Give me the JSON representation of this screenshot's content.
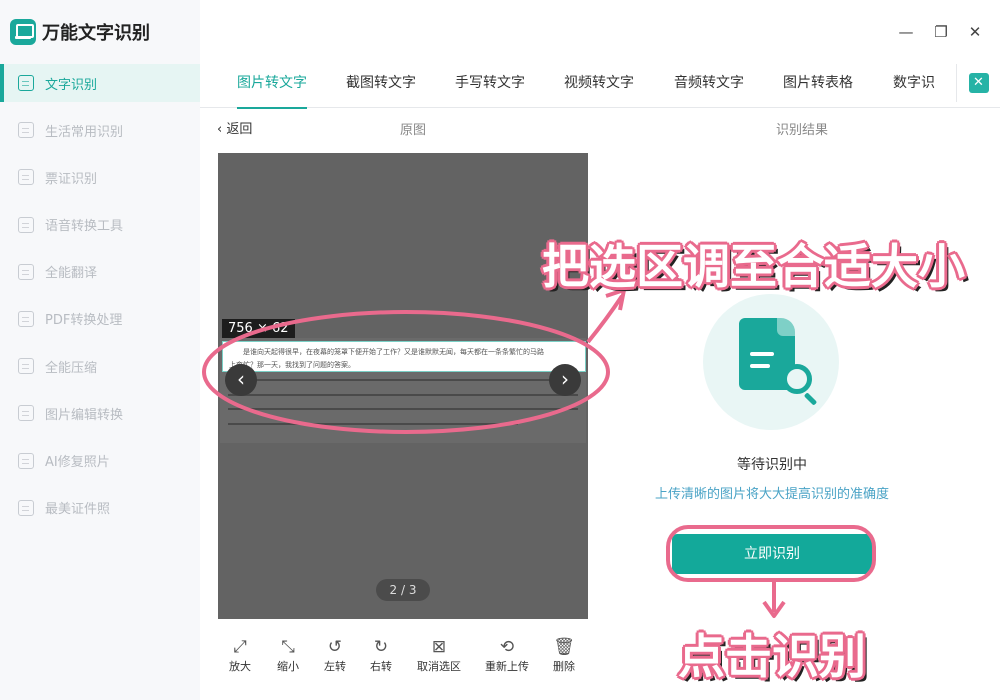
{
  "app": {
    "name": "万能文字识别"
  },
  "window": {
    "minimize": "—",
    "maximize": "❐",
    "close": "✕"
  },
  "sidebar": {
    "items": [
      {
        "label": "文字识别",
        "active": true
      },
      {
        "label": "生活常用识别"
      },
      {
        "label": "票证识别"
      },
      {
        "label": "语音转换工具"
      },
      {
        "label": "全能翻译"
      },
      {
        "label": "PDF转换处理"
      },
      {
        "label": "全能压缩"
      },
      {
        "label": "图片编辑转换"
      },
      {
        "label": "AI修复照片"
      },
      {
        "label": "最美证件照"
      }
    ]
  },
  "tabs": [
    {
      "label": "图片转文字",
      "active": true
    },
    {
      "label": "截图转文字"
    },
    {
      "label": "手写转文字"
    },
    {
      "label": "视频转文字"
    },
    {
      "label": "音频转文字"
    },
    {
      "label": "图片转表格"
    },
    {
      "label": "数字识"
    }
  ],
  "subheader": {
    "back": "返回",
    "original": "原图",
    "result": "识别结果"
  },
  "preview": {
    "selection_size": "756 × 62",
    "selection_line1": "是谁向天起得很早，在夜幕的笼罩下便开始了工作？又是谁默默无闻，每天都在一条条繁忙的马路",
    "selection_line2": "上奔忙？那一天，我找到了问题的答案。",
    "prev": "‹",
    "next": "›",
    "page_indicator": "2 / 3"
  },
  "toolbar": {
    "zoom_in": "放大",
    "zoom_out": "缩小",
    "rotate_left": "左转",
    "rotate_right": "右转",
    "cancel_selection": "取消选区",
    "reupload": "重新上传",
    "delete": "删除"
  },
  "result": {
    "status": "等待识别中",
    "tip": "上传清晰的图片将大大提高识别的准确度",
    "button": "立即识别"
  },
  "annotations": {
    "adjust": "把选区调至合适大小",
    "click": "点击识别"
  },
  "colors": {
    "accent": "#1aa89b",
    "annotation": "#e96a8d"
  }
}
